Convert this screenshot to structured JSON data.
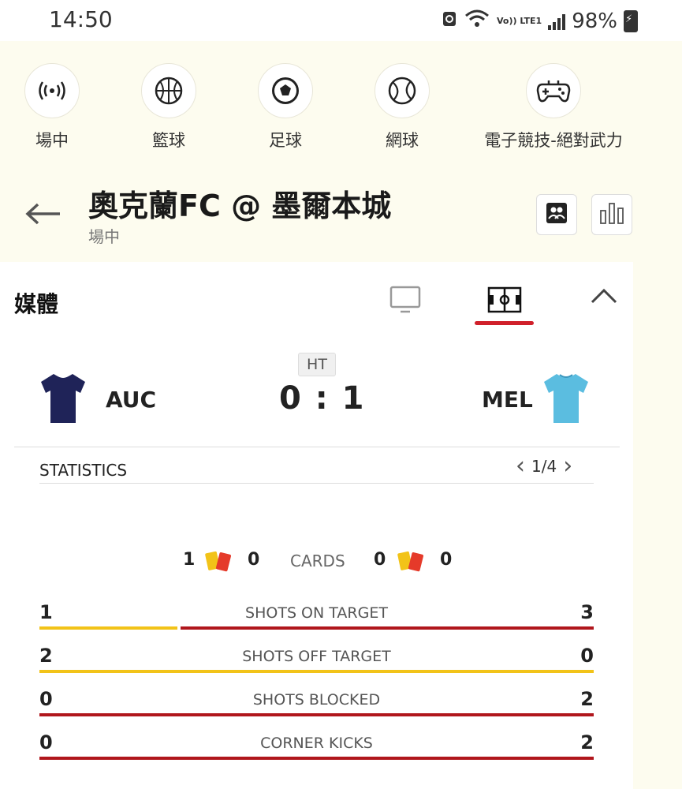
{
  "status_bar": {
    "time": "14:50",
    "lte": "Vo)) LTE1",
    "battery": "98%"
  },
  "categories": [
    {
      "label": "場中",
      "icon": "live-broadcast-icon"
    },
    {
      "label": "籃球",
      "icon": "basketball-icon"
    },
    {
      "label": "足球",
      "icon": "soccer-ball-icon"
    },
    {
      "label": "網球",
      "icon": "tennis-ball-icon"
    },
    {
      "label": "電子競技-絕對武力",
      "icon": "gamepad-icon"
    }
  ],
  "header": {
    "title": "奧克蘭FC @ 墨爾本城",
    "subtitle": "場中"
  },
  "media": {
    "title": "媒體"
  },
  "match": {
    "status": "HT",
    "home": {
      "code": "AUC",
      "shirt_color": "#1f2358"
    },
    "away": {
      "code": "MEL",
      "shirt_color": "#5bbde0"
    },
    "score": "0 : 1"
  },
  "statistics": {
    "heading": "STATISTICS",
    "page": "1/4",
    "cards": {
      "label": "CARDS",
      "home_yellow": "1",
      "home_red": "0",
      "away_yellow": "0",
      "away_red": "0"
    },
    "rows": [
      {
        "label": "SHOTS ON TARGET",
        "home": "1",
        "away": "3",
        "home_value": 1,
        "away_value": 3
      },
      {
        "label": "SHOTS OFF TARGET",
        "home": "2",
        "away": "0",
        "home_value": 2,
        "away_value": 0
      },
      {
        "label": "SHOTS BLOCKED",
        "home": "0",
        "away": "2",
        "home_value": 0,
        "away_value": 2
      },
      {
        "label": "CORNER KICKS",
        "home": "0",
        "away": "2",
        "home_value": 0,
        "away_value": 2
      }
    ]
  },
  "colors": {
    "home_bar": "#f2c318",
    "away_bar": "#b0161c",
    "accent": "#d0202a"
  }
}
